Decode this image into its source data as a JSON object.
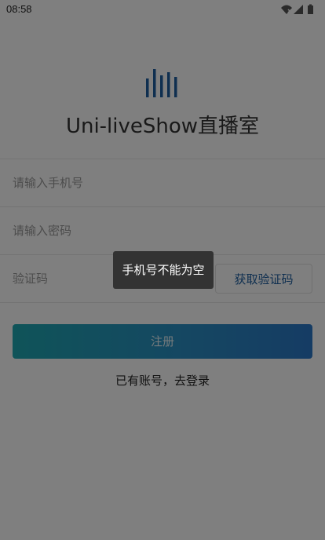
{
  "status_bar": {
    "time": "08:58",
    "icons": [
      "wifi-icon",
      "signal-icon",
      "battery-icon"
    ]
  },
  "app": {
    "title": "Uni-liveShow直播室",
    "logo_icon": "bar-equalizer-icon"
  },
  "form": {
    "phone_placeholder": "请输入手机号",
    "password_placeholder": "请输入密码",
    "code_placeholder": "验证码",
    "get_code_label": "获取验证码",
    "register_label": "注册",
    "login_link_label": "已有账号，去登录"
  },
  "toast": {
    "message": "手机号不能为空"
  },
  "colors": {
    "accent_blue": "#1e5fa0",
    "button_gradient_start": "#1fa8b2",
    "button_gradient_end": "#2b78c8",
    "overlay": "rgba(0,0,0,0.5)",
    "toast_bg": "#333333"
  }
}
